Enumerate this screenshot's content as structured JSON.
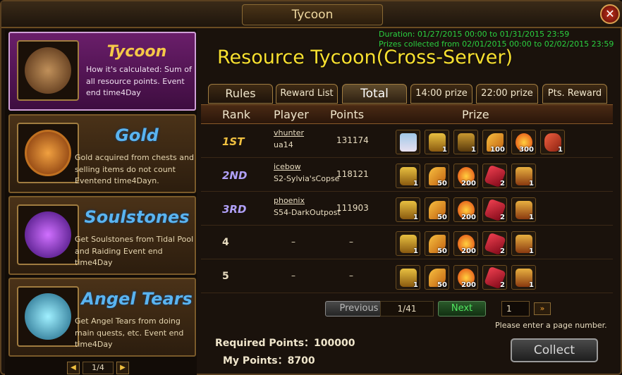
{
  "window": {
    "title": "Tycoon"
  },
  "left_cards": [
    {
      "title": "Tycoon",
      "desc": "How it's calculated: Sum of all resource points. Event end time4Day",
      "icon": "merchant-portrait"
    },
    {
      "title": "Gold",
      "desc": "Gold acquired from chests and selling items do not count Eventend time4Dayn.",
      "icon": "gold-coin"
    },
    {
      "title": "Soulstones",
      "desc": "Get Soulstones from Tidal Pool and Raiding Event end time4Day",
      "icon": "soulstone-orb"
    },
    {
      "title": "Angel Tears",
      "desc": "Get Angel Tears from doing main quests, etc. Event end time4Day",
      "icon": "angel-tears-flask"
    }
  ],
  "left_pager": {
    "page": "1/4"
  },
  "main": {
    "duration": "Duration: 01/27/2015 00:00 to 01/31/2015 23:59",
    "prizes_collected": "Prizes collected from 02/01/2015 00:00 to 02/02/2015 23:59",
    "headline": "Resource Tycoon(Cross-Server)"
  },
  "tabs": [
    "Rules",
    "Reward List",
    "Total",
    "14:00 prize",
    "22:00 prize",
    "Pts. Reward"
  ],
  "columns": {
    "rank": "Rank",
    "player": "Player",
    "points": "Points",
    "prize": "Prize"
  },
  "rows": [
    {
      "rank": "1ST",
      "name": "vhunter",
      "server": "ua14",
      "points": "131174",
      "prizes": [
        {
          "type": "portrait",
          "qty": ""
        },
        {
          "type": "chest",
          "qty": "1"
        },
        {
          "type": "hood",
          "qty": "1"
        },
        {
          "type": "feather",
          "qty": "100"
        },
        {
          "type": "orb",
          "qty": "300"
        },
        {
          "type": "stone",
          "qty": "1"
        }
      ]
    },
    {
      "rank": "2ND",
      "name": "icebow",
      "server": "S2-Sylvia'sCopse",
      "points": "118121",
      "prizes": [
        {
          "type": "chest",
          "qty": "1"
        },
        {
          "type": "feather",
          "qty": "50"
        },
        {
          "type": "orb",
          "qty": "200"
        },
        {
          "type": "ruby",
          "qty": "2"
        },
        {
          "type": "armor",
          "qty": "1"
        }
      ]
    },
    {
      "rank": "3RD",
      "name": "phoenix",
      "server": "S54-DarkOutpost",
      "points": "111903",
      "prizes": [
        {
          "type": "chest",
          "qty": "1"
        },
        {
          "type": "feather",
          "qty": "50"
        },
        {
          "type": "orb",
          "qty": "200"
        },
        {
          "type": "ruby",
          "qty": "2"
        },
        {
          "type": "armor",
          "qty": "1"
        }
      ]
    },
    {
      "rank": "4",
      "name": "",
      "server": "",
      "points": "",
      "player_dash": "–",
      "points_dash": "–",
      "prizes": [
        {
          "type": "chest",
          "qty": "1"
        },
        {
          "type": "feather",
          "qty": "50"
        },
        {
          "type": "orb",
          "qty": "200"
        },
        {
          "type": "ruby",
          "qty": "2"
        },
        {
          "type": "armor",
          "qty": "1"
        }
      ]
    },
    {
      "rank": "5",
      "name": "",
      "server": "",
      "points": "",
      "player_dash": "–",
      "points_dash": "–",
      "prizes": [
        {
          "type": "chest",
          "qty": "1"
        },
        {
          "type": "feather",
          "qty": "50"
        },
        {
          "type": "orb",
          "qty": "200"
        },
        {
          "type": "ruby",
          "qty": "2"
        },
        {
          "type": "armor",
          "qty": "1"
        }
      ]
    }
  ],
  "pagination": {
    "previous": "Previous",
    "indicator": "1/41",
    "next": "Next",
    "input_value": "1",
    "go": "»",
    "hint": "Please enter a page number."
  },
  "footer": {
    "required": "Required Points：100000",
    "my_points": "My Points：8700",
    "collect": "Collect"
  },
  "colors": {
    "headline": "#f8e030",
    "green_text": "#2ad040",
    "active_card": "#6a1e6a"
  }
}
